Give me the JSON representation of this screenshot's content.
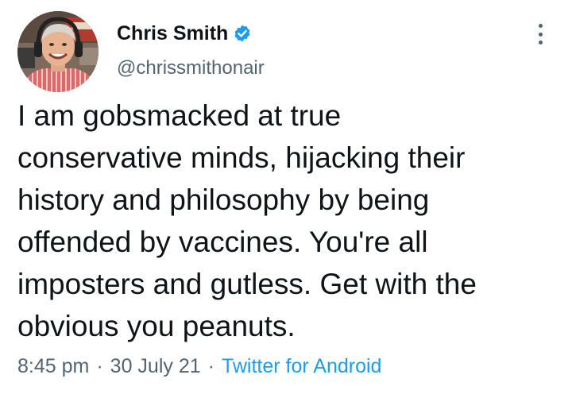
{
  "author": {
    "display_name": "Chris Smith",
    "handle": "@chrissmithonair",
    "verified": true
  },
  "tweet": {
    "text": "I am gobsmacked at true\nconservative minds, hijacking their\nhistory and philosophy by being\noffended by vaccines. You're all\nimposters and gutless. Get with the\nobvious you peanuts.",
    "time": "8:45 pm",
    "date": "30 July 21",
    "separator": "·",
    "source": "Twitter for Android"
  },
  "icons": {
    "verified": "verified-badge-icon",
    "more": "more-options-icon"
  },
  "colors": {
    "text_primary": "#0f1419",
    "text_secondary": "#536471",
    "accent": "#1d9bf0"
  }
}
